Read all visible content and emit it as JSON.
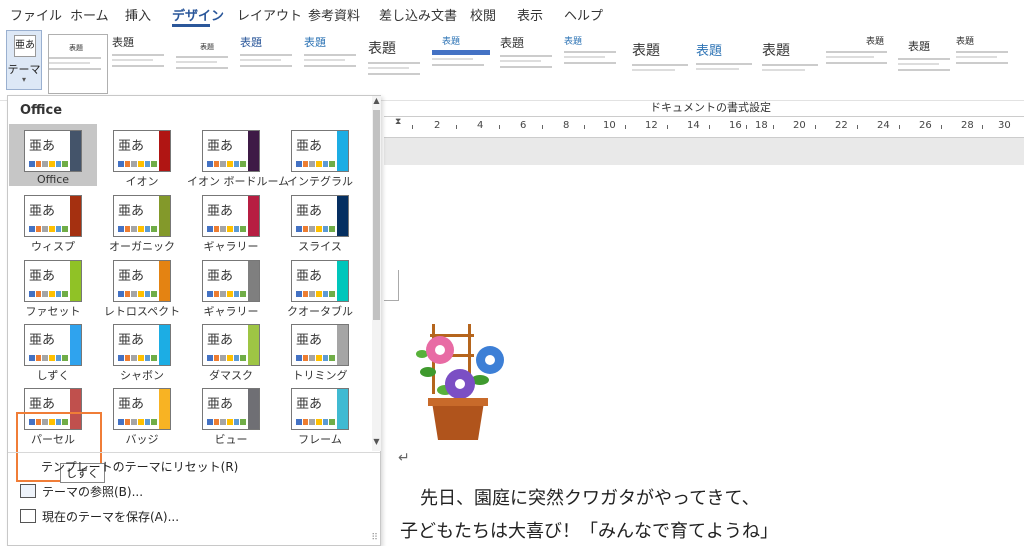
{
  "menu": {
    "items": [
      "ファイル",
      "ホーム",
      "挿入",
      "デザイン",
      "レイアウト",
      "参考資料",
      "差し込み文書",
      "校閲",
      "表示",
      "ヘルプ"
    ],
    "active": "デザイン"
  },
  "ribbon": {
    "theme_button_label": "テーマ",
    "theme_button_icon_text": "亜あ",
    "style_titles": [
      "表題",
      "表題",
      "表題",
      "表題",
      "表題",
      "表題",
      "表題",
      "表題",
      "表題",
      "表題",
      "表題"
    ],
    "group_label": "ドキュメントの書式設定"
  },
  "ruler": {
    "numbers": [
      "2",
      "4",
      "6",
      "8",
      "10",
      "12",
      "14",
      "16",
      "18",
      "20",
      "22",
      "24",
      "26",
      "28",
      "30"
    ]
  },
  "theme_panel": {
    "header": "Office",
    "themes": [
      {
        "label": "Office",
        "accent": "#44546a"
      },
      {
        "label": "イオン",
        "accent": "#b01513"
      },
      {
        "label": "イオン ボードルーム",
        "accent": "#3e1a46"
      },
      {
        "label": "インテグラル",
        "accent": "#1cade4"
      },
      {
        "label": "ウィスプ",
        "accent": "#a53010"
      },
      {
        "label": "オーガニック",
        "accent": "#83992a"
      },
      {
        "label": "ギャラリー",
        "accent": "#b71e42"
      },
      {
        "label": "スライス",
        "accent": "#052f61"
      },
      {
        "label": "ファセット",
        "accent": "#90c226"
      },
      {
        "label": "レトロスペクト",
        "accent": "#e48312"
      },
      {
        "label": "ギャラリー",
        "accent": "#7f7f7f"
      },
      {
        "label": "クオータブル",
        "accent": "#00c6bb"
      },
      {
        "label": "しずく",
        "accent": "#2fa3ee"
      },
      {
        "label": "シャボン",
        "accent": "#1cade4"
      },
      {
        "label": "ダマスク",
        "accent": "#9ec544"
      },
      {
        "label": "トリミング",
        "accent": "#a5a5a5"
      },
      {
        "label": "パーセル",
        "accent": "#c0504d"
      },
      {
        "label": "バッジ",
        "accent": "#f8b323"
      },
      {
        "label": "ビュー",
        "accent": "#6f6f74"
      },
      {
        "label": "フレーム",
        "accent": "#40bad2"
      }
    ],
    "swatch_colors": [
      "#4472c4",
      "#ed7d31",
      "#a5a5a5",
      "#ffc000",
      "#5b9bd5",
      "#70ad47"
    ],
    "tooltip": "しずく",
    "commands": {
      "reset": "テンプレートのテーマにリセット(R)",
      "browse": "テーマの参照(B)...",
      "save": "現在のテーマを保存(A)..."
    }
  },
  "document": {
    "line1": "先日、園庭に突然クワガタがやってきて、",
    "line2": "子どもたちは大喜び！「みんなで育てようね」"
  }
}
